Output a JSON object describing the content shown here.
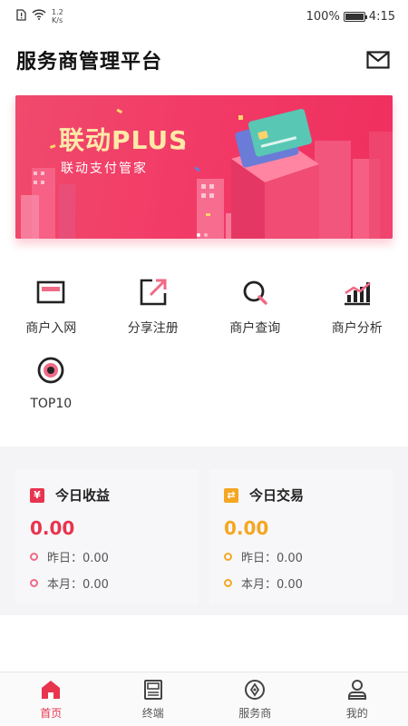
{
  "status_bar": {
    "speed_value": "1.2",
    "speed_unit": "K/s",
    "battery": "100%",
    "battery_level": 1.0,
    "time": "4:15"
  },
  "header": {
    "title": "服务商管理平台"
  },
  "banner": {
    "title": "联动PLUS",
    "subtitle": "联动支付管家",
    "dots": 2,
    "active_dot": 0
  },
  "menu": {
    "items": [
      {
        "label": "商户入网",
        "icon": "card-icon"
      },
      {
        "label": "分享注册",
        "icon": "share-icon"
      },
      {
        "label": "商户查询",
        "icon": "search-icon"
      },
      {
        "label": "商户分析",
        "icon": "chart-icon"
      },
      {
        "label": "TOP10",
        "icon": "target-icon"
      }
    ]
  },
  "cards": {
    "income": {
      "badge": "¥",
      "title": "今日收益",
      "amount": "0.00",
      "yesterday": "昨日：0.00",
      "month": "本月：0.00",
      "color": "#e8344f"
    },
    "trade": {
      "badge": "⇄",
      "title": "今日交易",
      "amount": "0.00",
      "yesterday": "昨日：0.00",
      "month": "本月：0.00",
      "color": "#f5a623"
    }
  },
  "tabbar": {
    "tabs": [
      {
        "label": "首页",
        "active": true
      },
      {
        "label": "终端",
        "active": false
      },
      {
        "label": "服务商",
        "active": false
      },
      {
        "label": "我的",
        "active": false
      }
    ]
  },
  "colors": {
    "accent": "#e8344f",
    "orange": "#f5a623",
    "banner": "#f23b67"
  }
}
